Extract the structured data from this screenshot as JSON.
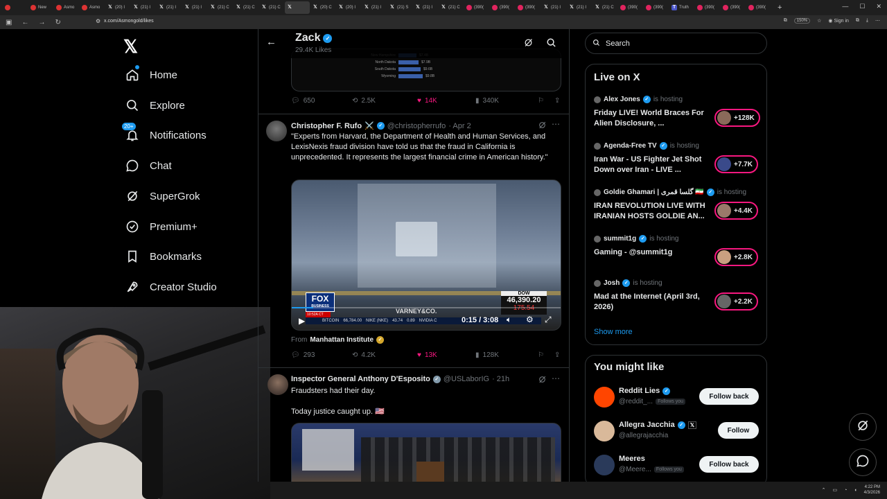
{
  "browser": {
    "tabs": [
      {
        "label": "",
        "favicon": "chrome-icon"
      },
      {
        "label": "New",
        "favicon": "red"
      },
      {
        "label": "Asmo",
        "favicon": "red"
      },
      {
        "label": "Asmo",
        "favicon": "red"
      },
      {
        "label": "(20) I",
        "favicon": "x"
      },
      {
        "label": "(21) I",
        "favicon": "x"
      },
      {
        "label": "(21) I",
        "favicon": "x"
      },
      {
        "label": "(21) I",
        "favicon": "x"
      },
      {
        "label": "(21) C",
        "favicon": "x"
      },
      {
        "label": "(21) C",
        "favicon": "x"
      },
      {
        "label": "(21) C",
        "favicon": "x"
      },
      {
        "label": "",
        "favicon": "x",
        "active": true
      },
      {
        "label": "(20) C",
        "favicon": "x"
      },
      {
        "label": "(20) I",
        "favicon": "x"
      },
      {
        "label": "(21) I",
        "favicon": "x"
      },
      {
        "label": "(21) S",
        "favicon": "x"
      },
      {
        "label": "(21) I",
        "favicon": "x"
      },
      {
        "label": "(21) C",
        "favicon": "x"
      },
      {
        "label": "(390(",
        "favicon": "yt"
      },
      {
        "label": "(390(",
        "favicon": "yt"
      },
      {
        "label": "(390(",
        "favicon": "yt"
      },
      {
        "label": "(21) I",
        "favicon": "x"
      },
      {
        "label": "(21) I",
        "favicon": "x"
      },
      {
        "label": "(21) C",
        "favicon": "x"
      },
      {
        "label": "(390(",
        "favicon": "yt"
      },
      {
        "label": "(390(",
        "favicon": "yt"
      },
      {
        "label": "Truth",
        "favicon": "ts"
      },
      {
        "label": "(390(",
        "favicon": "yt"
      },
      {
        "label": "(390(",
        "favicon": "yt"
      },
      {
        "label": "(390(",
        "favicon": "yt"
      }
    ],
    "url": "x.com/Asmongold/likes",
    "zoom": "150%",
    "signin": "Sign in"
  },
  "nav": {
    "items": [
      {
        "label": "Home",
        "icon": "home-icon"
      },
      {
        "label": "Explore",
        "icon": "search-icon"
      },
      {
        "label": "Notifications",
        "icon": "bell-icon",
        "badge": "20+"
      },
      {
        "label": "Chat",
        "icon": "chat-icon"
      },
      {
        "label": "SuperGrok",
        "icon": "grok-icon"
      },
      {
        "label": "Premium+",
        "icon": "premium-icon"
      },
      {
        "label": "Bookmarks",
        "icon": "bookmark-icon"
      },
      {
        "label": "Creator Studio",
        "icon": "rocket-icon"
      }
    ]
  },
  "header": {
    "name": "Zack",
    "likes": "29.4K Likes"
  },
  "prev_tweet": {
    "chart_rows": [
      {
        "label": "New Hampshire",
        "value": "$7.4B"
      },
      {
        "label": "North Dakota",
        "value": "$7.9B"
      },
      {
        "label": "South Dakota",
        "value": "$9.6B"
      },
      {
        "label": "Wyoming",
        "value": "$9.8B"
      }
    ],
    "actions": {
      "replies": "650",
      "reposts": "2.5K",
      "likes": "14K",
      "views": "340K"
    }
  },
  "tweet1": {
    "name": "Christopher F. Rufo",
    "emoji": "⚔️",
    "handle": "@christopherrufo",
    "date": "· Apr 2",
    "text": "\"Experts from Harvard, the Department of Health and Human Services, and LexisNexis fraud division have told us that the fraud in California is unprecedented. It represents the largest financial crime in American history.\"",
    "video": {
      "time": "0:15 / 3:08",
      "ticker_label": "DOW",
      "ticker_value": "46,390.20",
      "ticker_change": "175.54",
      "network": "FOX",
      "network_sub": "BUSINESS",
      "show": "VARNEY&CO.",
      "clock": "10:52A CT",
      "bitcoin_label": "BITCOIN",
      "bitcoin_value": "66,784.00",
      "nike": "NIKE (NKE)",
      "nike_value": "43.74",
      "nike_change": "0.89",
      "nvidia": "NVIDIA C"
    },
    "from_label": "From",
    "from_source": "Manhattan Institute",
    "actions": {
      "replies": "293",
      "reposts": "4.2K",
      "likes": "13K",
      "views": "128K"
    }
  },
  "tweet2": {
    "name": "Inspector General Anthony D'Esposito",
    "handle": "@USLaborIG",
    "date": "· 21h",
    "line1": "Fraudsters had their day.",
    "line2": "Today justice caught up. 🇺🇸"
  },
  "right": {
    "search_placeholder": "Search",
    "live": {
      "title": "Live on X",
      "hosting_label": "is hosting",
      "items": [
        {
          "host": "Alex Jones",
          "title": "Friday LIVE! World Braces For Alien Disclosure, ...",
          "count": "+128K"
        },
        {
          "host": "Agenda-Free TV",
          "title": "Iran War - US Fighter Jet Shot Down over Iran - LIVE ...",
          "count": "+7.7K"
        },
        {
          "host": "Goldie Ghamari | گلسا قمری 🇮🇷",
          "title": "IRAN REVOLUTION LIVE WITH IRANIAN HOSTS GOLDIE AN...",
          "count": "+4.4K"
        },
        {
          "host": "summit1g",
          "title": "Gaming - @summit1g",
          "count": "+2.8K"
        },
        {
          "host": "Josh",
          "title": "Mad at the Internet (April 3rd, 2026)",
          "count": "+2.2K"
        }
      ],
      "show_more": "Show more"
    },
    "suggest": {
      "title": "You might like",
      "follows_you": "Follows you",
      "items": [
        {
          "name": "Reddit Lies",
          "handle": "@reddit_...",
          "follows_you": true,
          "button": "Follow back"
        },
        {
          "name": "Allegra Jacchia",
          "handle": "@allegrajacchia",
          "follows_you": false,
          "button": "Follow"
        },
        {
          "name": "Meeres",
          "handle": "@Meere...",
          "follows_you": true,
          "button": "Follow back"
        }
      ]
    }
  },
  "taskbar": {
    "time": "4:22 PM",
    "date": "4/3/2026"
  },
  "colors": {
    "accent": "#1d9bf0",
    "like": "#f91880",
    "bg": "#000000",
    "border": "#2f3336",
    "muted": "#71767b"
  }
}
